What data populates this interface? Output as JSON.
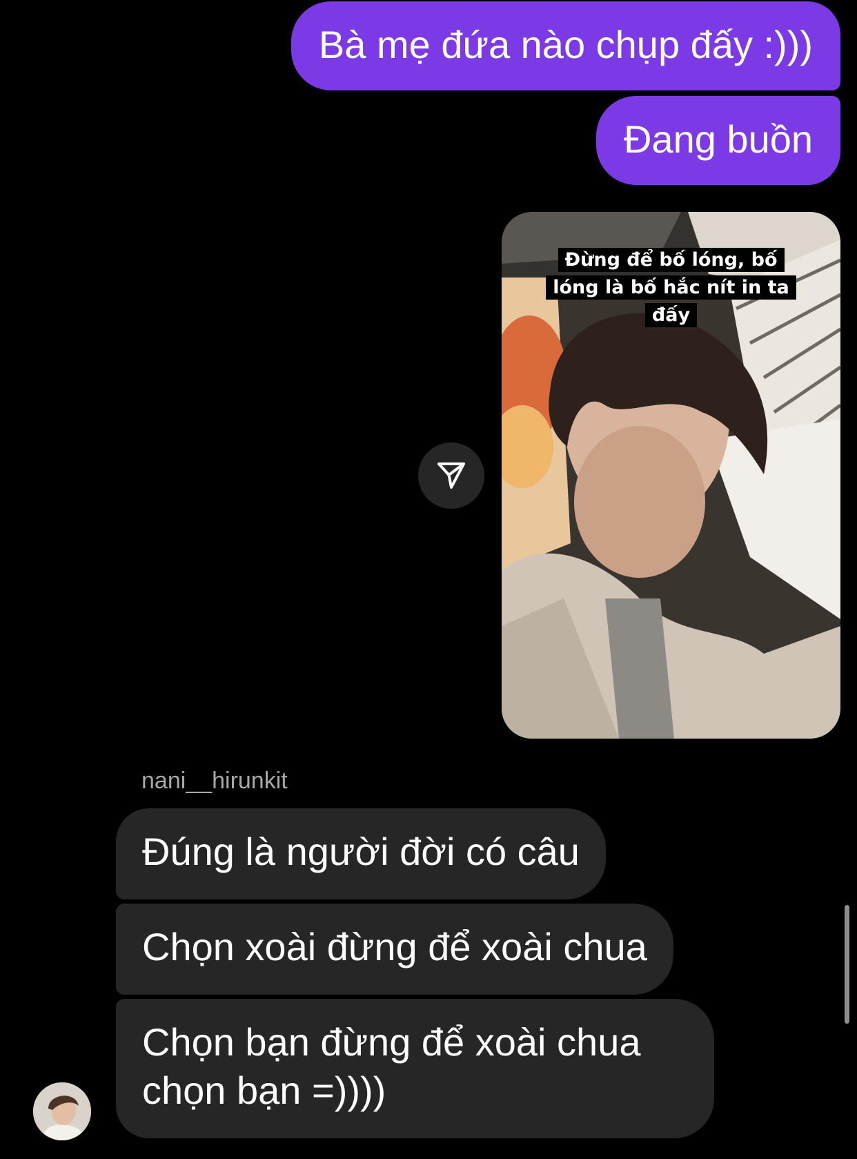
{
  "colors": {
    "background": "#000000",
    "outgoing_bubble": "#7c3ae6",
    "incoming_bubble": "#262626",
    "sender_name": "#a8a8a8"
  },
  "messages_out": [
    {
      "text": "Bà mẹ đứa nào chụp đấy :)))"
    },
    {
      "text": "Đang buồn"
    }
  ],
  "story_reply": {
    "caption_line1": "Đừng để bố lóng, bố",
    "caption_line2": "lóng là bố hắc nít in ta",
    "caption_line3": "đấy",
    "share_icon": "paper-plane-icon"
  },
  "sender": {
    "username": "nani__hirunkit",
    "avatar_icon": "profile-avatar"
  },
  "messages_in": [
    {
      "text": "Đúng là người đời có câu"
    },
    {
      "text": "Chọn xoài đừng để xoài chua"
    },
    {
      "text": "Chọn bạn đừng để xoài chua chọn bạn =))))"
    }
  ]
}
